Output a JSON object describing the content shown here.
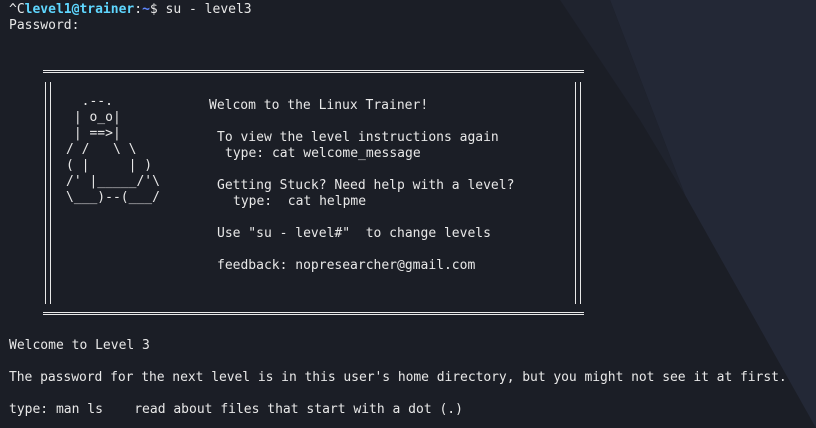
{
  "terminal": {
    "prompt_ctrl": "^C",
    "prompt_user": "level1@trainer",
    "prompt_sep": ":",
    "prompt_path": "~",
    "prompt_symbol": "$",
    "command": " su - level3",
    "password_prompt": "Password:"
  },
  "banner": {
    "ascii_art": "  .--.\n | o_o|\n | ==>|\n/ /   \\ \\\n( |     | )\n/' |_____/'\\\n\\___)--(___/",
    "welcome": "Welcom to the Linux Trainer!",
    "instructions_line1": "To view the level instructions again",
    "instructions_line2": "type: cat welcome_message",
    "stuck_line1": "Getting Stuck? Need help with a level?",
    "stuck_line2": "type:  cat helpme",
    "su_hint": "Use \"su - level#\"  to change levels",
    "feedback": "feedback: nopresearcher@gmail.com"
  },
  "output": {
    "level_welcome": "Welcome to Level 3",
    "password_hint": "The password for the next level is in this user's home directory, but you might not see it at first.",
    "type_hint": "type: man ls    read about files that start with a dot (.)"
  },
  "colors": {
    "background": "#1b1e26",
    "foreground": "#e8e8e8",
    "user": "#5fd7ff",
    "path": "#5f87ff"
  }
}
